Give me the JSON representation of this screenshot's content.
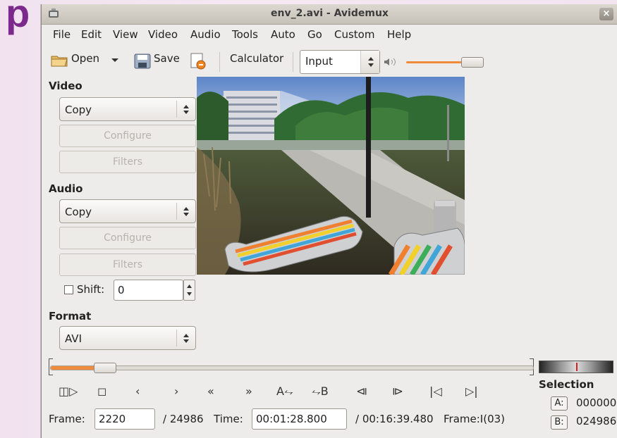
{
  "background_letter": "p",
  "window": {
    "title": "env_2.avi - Avidemux",
    "close_icon": "close-icon"
  },
  "menu": [
    {
      "label": "File"
    },
    {
      "label": "Edit"
    },
    {
      "label": "View"
    },
    {
      "label": "Video"
    },
    {
      "label": "Audio"
    },
    {
      "label": "Tools"
    },
    {
      "label": "Auto"
    },
    {
      "label": "Go"
    },
    {
      "label": "Custom"
    },
    {
      "label": "Help"
    }
  ],
  "toolbar": {
    "open_label": "Open",
    "save_label": "Save",
    "calculator_label": "Calculator",
    "input_select": "Input",
    "volume_level": 0.75
  },
  "video_panel": {
    "heading": "Video",
    "codec": "Copy",
    "configure_label": "Configure",
    "filters_label": "Filters"
  },
  "audio_panel": {
    "heading": "Audio",
    "codec": "Copy",
    "configure_label": "Configure",
    "filters_label": "Filters",
    "shift_label": "Shift:",
    "shift_value": "0"
  },
  "format_panel": {
    "heading": "Format",
    "value": "AVI"
  },
  "timeline": {
    "position_fraction": 0.0888
  },
  "status": {
    "frame_label": "Frame:",
    "frame_value": "2220",
    "frame_total": "/ 24986",
    "time_label": "Time:",
    "time_value": "00:01:28.800",
    "time_total": "/ 00:16:39.480",
    "frame_type": "Frame:I(03)"
  },
  "selection": {
    "heading": "Selection",
    "a_label": "A:",
    "a_value": "000000",
    "b_label": "B:",
    "b_value": "024986"
  },
  "colors": {
    "accent": "#f08a3c",
    "window_bg": "#edeceb"
  }
}
